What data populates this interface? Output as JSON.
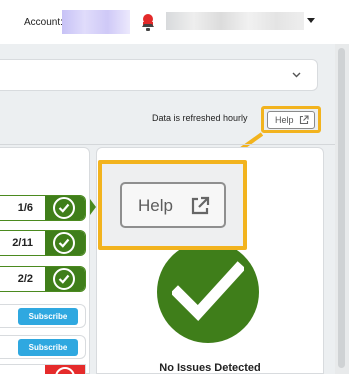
{
  "header": {
    "account_label": "Account:",
    "icons": {
      "notification": "bell-icon",
      "user_menu": "chevron-down-icon"
    }
  },
  "filter": {
    "icon": "chevron-down-icon"
  },
  "info": {
    "refresh_text": "Data is refreshed hourly"
  },
  "help_button": {
    "label": "Help",
    "icon": "external-link-icon"
  },
  "help_zoom": {
    "label": "Help",
    "icon": "external-link-icon"
  },
  "rows": [
    {
      "count": "1/6",
      "status": "ok"
    },
    {
      "count": "2/11",
      "status": "ok"
    },
    {
      "count": "2/2",
      "status": "ok"
    }
  ],
  "subscribe_rows": [
    {
      "button": "Subscribe"
    },
    {
      "button": "Subscribe"
    }
  ],
  "summary": {
    "status_text": "No Issues Detected",
    "icon": "check-circle-icon"
  },
  "colors": {
    "accent_highlight": "#f2b31e",
    "success_green": "#3f7e1a",
    "subscribe_blue": "#2fa8e0",
    "alert_red": "#e52b2b"
  }
}
